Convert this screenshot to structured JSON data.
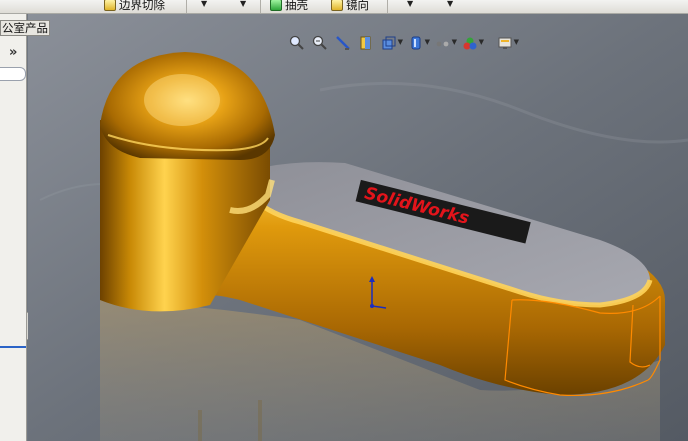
{
  "toolbar": {
    "items": [
      {
        "label": "边界切除",
        "icon": "boundary-cut-icon"
      },
      {
        "label": "抽壳",
        "icon": "shell-icon"
      },
      {
        "label": "镜向",
        "icon": "mirror-icon"
      }
    ],
    "dropdown_glyph": "▼"
  },
  "left_panel": {
    "tab_label": "公室产品",
    "expand_glyph": "»"
  },
  "viewport": {
    "logo_text": "SolidWorks",
    "hud_icons": [
      "zoom-to-fit-icon",
      "zoom-to-area-icon",
      "previous-view-icon",
      "section-view-icon",
      "view-orientation-icon",
      "display-style-icon",
      "hide-show-items-icon",
      "edit-appearance-icon",
      "apply-scene-icon",
      "view-settings-icon"
    ]
  },
  "colors": {
    "viewport_background": "#6f7680",
    "model_gold": "#c98a06",
    "model_highlight": "#ffd24a",
    "selection_edge": "#ff8a00",
    "logo_red": "#e3141b",
    "triad_blue": "#1a2dbf"
  }
}
